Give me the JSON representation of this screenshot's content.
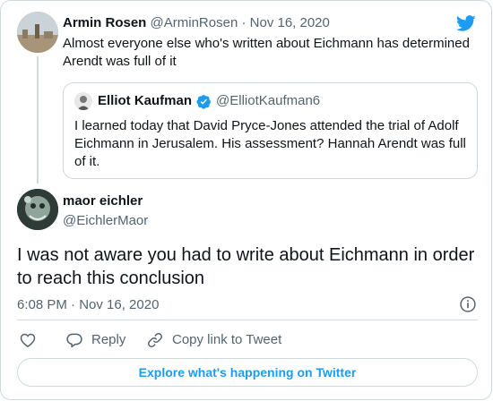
{
  "parent_tweet": {
    "author_name": "Armin Rosen",
    "author_handle": "@ArminRosen",
    "separator": "·",
    "date": "Nov 16, 2020",
    "text": "Almost everyone else who's written about Eichmann has determined Arendt was full of it"
  },
  "quoted_tweet": {
    "author_name": "Elliot Kaufman",
    "verified": true,
    "author_handle": "@ElliotKaufman6",
    "text": "I learned today that David Pryce-Jones attended the trial of Adolf Eichmann in Jerusalem. His assessment? Hannah Arendt was full of it."
  },
  "main_tweet": {
    "author_name": "maor eichler",
    "author_handle": "@EichlerMaor",
    "text": "I was not aware you had to write about Eichmann in order to reach this conclusion",
    "timestamp": "6:08 PM · Nov 16, 2020"
  },
  "actions": {
    "reply_label": "Reply",
    "copy_link_label": "Copy link to Tweet"
  },
  "explore_label": "Explore what's happening on Twitter",
  "colors": {
    "brand_blue": "#1d9bf0",
    "text_primary": "#0f1419",
    "text_secondary": "#536471",
    "border": "#cfd9de"
  },
  "icons": [
    "twitter-bird-icon",
    "verified-badge-icon",
    "info-icon",
    "heart-icon",
    "reply-icon",
    "link-icon"
  ]
}
